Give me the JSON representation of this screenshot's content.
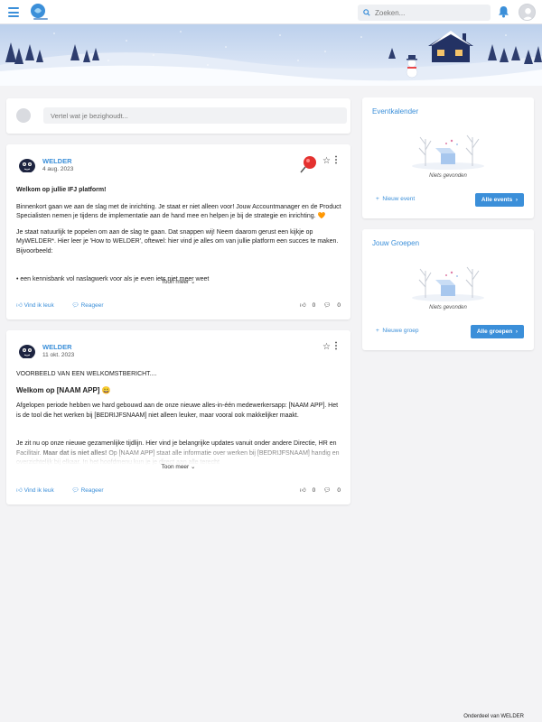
{
  "header": {
    "search_placeholder": "Zoeken...",
    "icons": [
      "menu-icon",
      "logo",
      "search-icon",
      "bell-icon",
      "user-avatar"
    ]
  },
  "composer": {
    "placeholder": "Vertel wat je bezighoudt..."
  },
  "posts": [
    {
      "author": "WELDER",
      "date": "4 aug. 2023",
      "pinned": true,
      "title": "Welkom op jullie IFJ platform!",
      "p1": "Binnenkort gaan we aan de slag met de inrichting. Je staat er niet alleen voor! Jouw Accountmanager en de Product Specialisten nemen je tijdens de implementatie aan de hand mee en helpen je bij de strategie en inrichting.",
      "p1_emoji": "🧡",
      "p2": "Je staat natuurlijk te popelen om aan de slag te gaan. Dat snappen wij! Neem daarom gerust een kijkje op MyWELDER*. Hier leer je 'How to WELDER', oftewel: hier vind je alles om van jullie platform een succes te maken. Bijvoorbeeld:",
      "p3": "• een kennisbank vol naslagwerk voor als je even iets niet meer weet",
      "more": "Toon meer",
      "like": "Vind ik leuk",
      "reply": "Reageer",
      "likes": "0",
      "comments": "0"
    },
    {
      "author": "WELDER",
      "date": "11 okt. 2023",
      "pinned": false,
      "intro": "VOORBEELD VAN EEN WELKOMSTBERICHT....",
      "title": "Welkom op [NAAM APP]",
      "title_emoji": "😀",
      "p1": "Afgelopen periode hebben we hard gebouwd aan de onze nieuwe alles-in-één medewerkersapp: [NAAM APP]. Het is de tool die het werken bij [BEDRIJFSNAAM] niet alleen leuker, maar vooral ook makkelijker maakt.",
      "p2a": "Je zit nu op onze nieuwe gezamenlijke tijdlijn. Hier vind je belangrijke updates vanuit onder andere Directie, HR en Facilitair. ",
      "p2b": "Maar dat is niet alles!",
      "p2c": " Op [NAAM APP] staat alle informatie over werken bij [BEDRIJFSNAAM] handig en overzichtelijk bij elkaar. In het hoofdmenu kun je je direct aan alle terecht",
      "more": "Toon meer",
      "like": "Vind ik leuk",
      "reply": "Reageer",
      "likes": "0",
      "comments": "0"
    }
  ],
  "events": {
    "title": "Eventkalender",
    "empty": "Niets gevonden",
    "new": "Nieuw event",
    "all": "Alle events"
  },
  "groups": {
    "title": "Jouw Groepen",
    "empty": "Niets gevonden",
    "new": "Nieuwe groep",
    "all": "Alle groepen"
  },
  "footer": "Onderdeel van WELDER"
}
